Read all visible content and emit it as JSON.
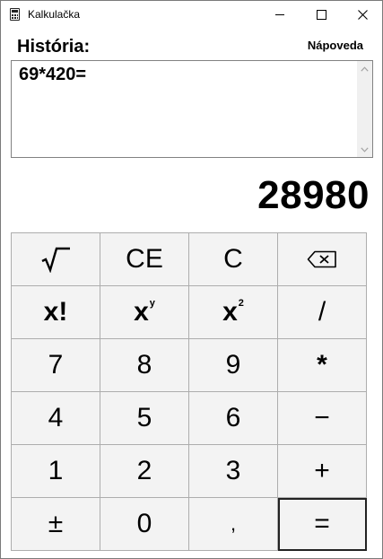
{
  "window": {
    "title": "Kalkulačka",
    "controls": {
      "minimize": "minimize-icon",
      "maximize": "maximize-icon",
      "close": "close-icon"
    }
  },
  "history": {
    "label": "História:",
    "text": "69*420="
  },
  "help_link": "Nápoveda",
  "display": {
    "value": "28980"
  },
  "keys": [
    {
      "name": "sqrt-button",
      "label": "√‾"
    },
    {
      "name": "clear-entry-button",
      "label": "CE"
    },
    {
      "name": "clear-button",
      "label": "C"
    },
    {
      "name": "backspace-button",
      "icon": "backspace-icon"
    },
    {
      "name": "factorial-button",
      "label": "x!"
    },
    {
      "name": "power-button",
      "label": "x",
      "sup": "y"
    },
    {
      "name": "square-button",
      "label": "x",
      "sup": "2"
    },
    {
      "name": "divide-button",
      "label": "/"
    },
    {
      "name": "digit-7-button",
      "label": "7"
    },
    {
      "name": "digit-8-button",
      "label": "8"
    },
    {
      "name": "digit-9-button",
      "label": "9"
    },
    {
      "name": "multiply-button",
      "label": "*"
    },
    {
      "name": "digit-4-button",
      "label": "4"
    },
    {
      "name": "digit-5-button",
      "label": "5"
    },
    {
      "name": "digit-6-button",
      "label": "6"
    },
    {
      "name": "minus-button",
      "label": "−"
    },
    {
      "name": "digit-1-button",
      "label": "1"
    },
    {
      "name": "digit-2-button",
      "label": "2"
    },
    {
      "name": "digit-3-button",
      "label": "3"
    },
    {
      "name": "plus-button",
      "label": "+"
    },
    {
      "name": "plus-minus-button",
      "label": "±"
    },
    {
      "name": "digit-0-button",
      "label": "0"
    },
    {
      "name": "decimal-button",
      "label": ","
    },
    {
      "name": "equals-button",
      "label": "="
    }
  ]
}
